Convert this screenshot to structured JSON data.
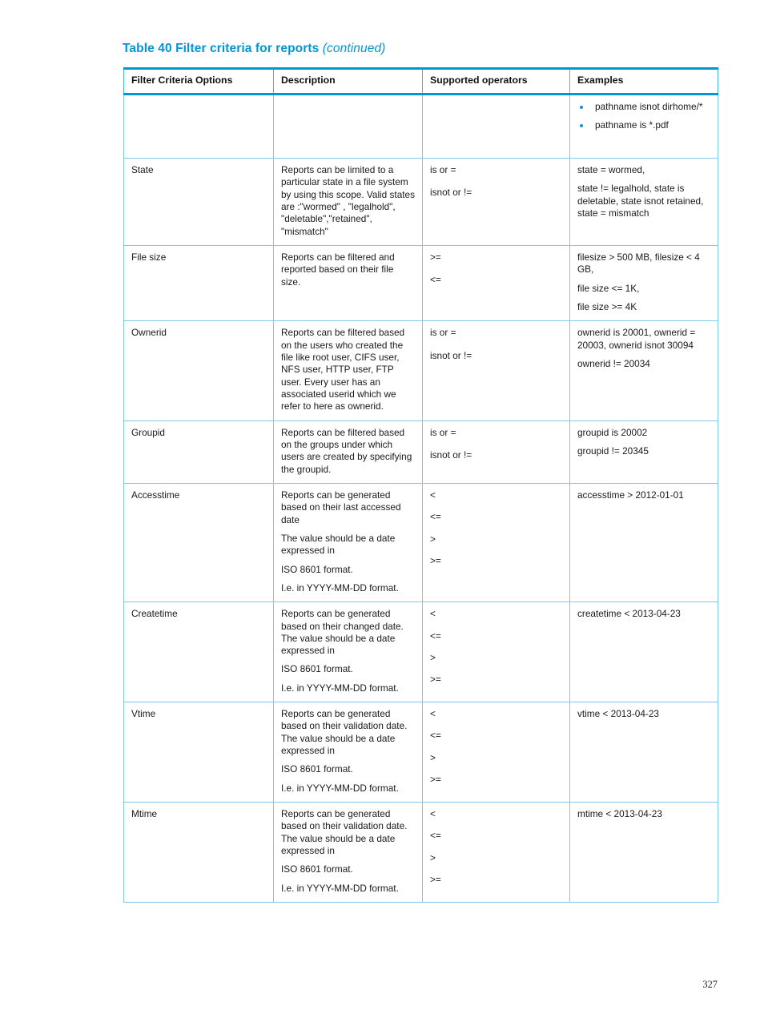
{
  "caption": {
    "main": "Table 40 Filter criteria for reports",
    "continued": "(continued)"
  },
  "table": {
    "headers": [
      "Filter Criteria Options",
      "Description",
      "Supported operators",
      "Examples"
    ],
    "rows": [
      {
        "option": "",
        "description": "",
        "operators": [],
        "examples_bullets": [
          "pathname isnot dirhome/*",
          "pathname is *.pdf"
        ],
        "examples": []
      },
      {
        "option": "State",
        "description": "Reports can be limited to a particular state in a file system by using this scope. Valid states are :\"wormed\" , \"legalhold\", \"deletable\",\"retained\", \"mismatch\"",
        "operators": [
          "is or =",
          "isnot or !="
        ],
        "examples": [
          "state = wormed,",
          "state != legalhold, state is deletable, state isnot retained, state = mismatch"
        ]
      },
      {
        "option": "File size",
        "description": "Reports can be filtered and reported based on their file size.",
        "operators": [
          ">=",
          "<="
        ],
        "examples": [
          "filesize > 500 MB, filesize < 4 GB,",
          "file size <= 1K,",
          "file size >= 4K"
        ]
      },
      {
        "option": "Ownerid",
        "description": "Reports can be filtered based on the users who created the file like root user, CIFS user, NFS user, HTTP user, FTP user. Every user has an associated userid which we refer to here as ownerid.",
        "operators": [
          "is or =",
          "isnot or !="
        ],
        "examples": [
          "ownerid is 20001, ownerid = 20003, ownerid isnot 30094",
          "ownerid != 20034"
        ]
      },
      {
        "option": "Groupid",
        "description": "Reports can be filtered based on the groups under which users are created by specifying the groupid.",
        "operators": [
          "is or =",
          "isnot or !="
        ],
        "examples": [
          "groupid is 20002",
          "groupid != 20345"
        ]
      },
      {
        "option": "Accesstime",
        "description_paragraphs": [
          "Reports can be generated based on their last accessed date",
          "The value should be a date expressed in",
          "ISO 8601 format.",
          "I.e. in YYYY-MM-DD format."
        ],
        "operators": [
          "<",
          "<=",
          ">",
          ">="
        ],
        "examples": [
          "accesstime > 2012-01-01"
        ]
      },
      {
        "option": "Createtime",
        "description_paragraphs": [
          "Reports can be generated based on their changed date. The value should be a date expressed in",
          "ISO 8601 format.",
          "I.e. in YYYY-MM-DD format."
        ],
        "operators": [
          "<",
          "<=",
          ">",
          ">="
        ],
        "examples": [
          "createtime < 2013-04-23"
        ]
      },
      {
        "option": "Vtime",
        "description_paragraphs": [
          "Reports can be generated based on their validation date. The value should be a date expressed in",
          "ISO 8601 format.",
          "I.e. in YYYY-MM-DD format."
        ],
        "operators": [
          "<",
          "<=",
          ">",
          ">="
        ],
        "examples": [
          "vtime < 2013-04-23"
        ]
      },
      {
        "option": "Mtime",
        "description_paragraphs": [
          "Reports can be generated based on their validation date. The value should be a date expressed in",
          "ISO 8601 format.",
          "I.e. in YYYY-MM-DD format."
        ],
        "operators": [
          "<",
          "<=",
          ">",
          ">="
        ],
        "examples": [
          "mtime < 2013-04-23"
        ]
      }
    ]
  },
  "footer": {
    "page_number": "327"
  },
  "colors": {
    "accent": "#0096d6",
    "rule": "#7fc9e8",
    "bullet": "#1a8fd4"
  }
}
